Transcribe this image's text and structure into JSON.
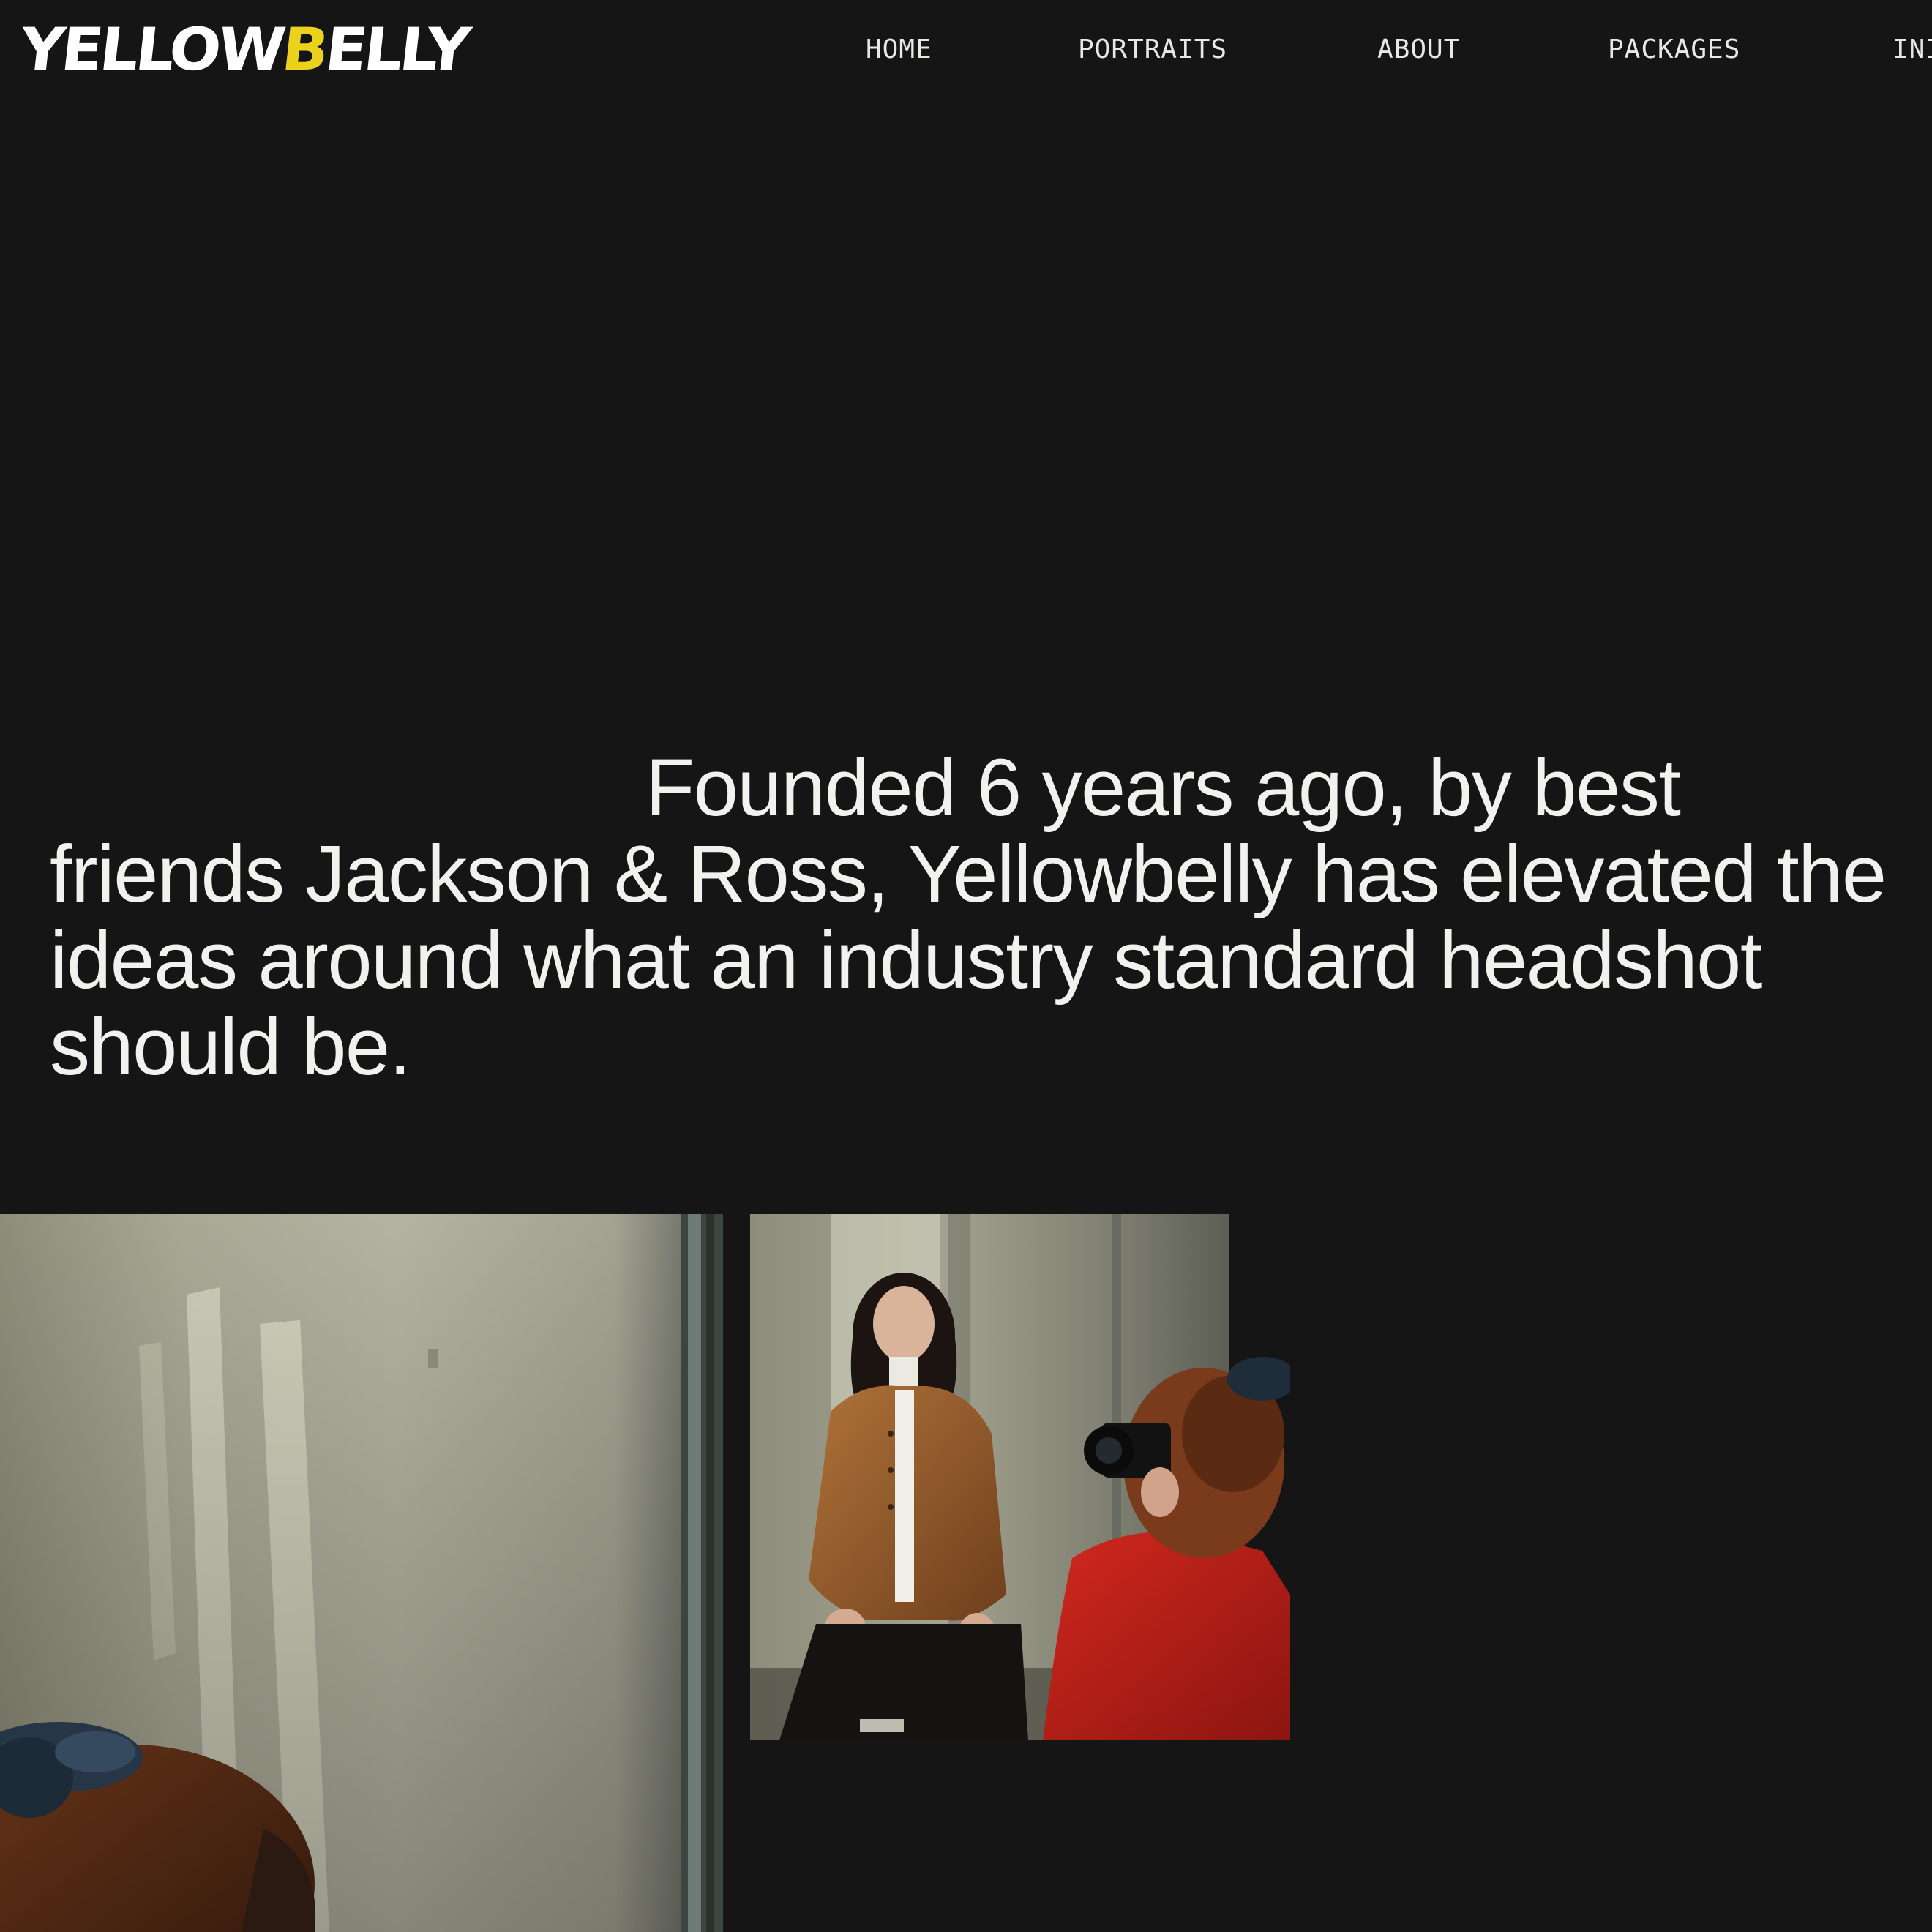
{
  "header": {
    "logo_text_a": "YELLOW",
    "logo_text_b": "B",
    "logo_text_c": "ELLY",
    "logo_accent_color": "#ecd21a",
    "nav": [
      {
        "label": "HOME"
      },
      {
        "label": "PORTRAITS"
      },
      {
        "label": "ABOUT"
      },
      {
        "label": "PACKAGES"
      },
      {
        "label": "INI"
      }
    ]
  },
  "intro": {
    "text": "Founded 6 years ago, by best friends Jackson & Ross, Yellowbelly has elevated the ideas around what an industry standard headshot should be."
  },
  "theme": {
    "background": "#151516",
    "text": "#f1f1ee"
  }
}
